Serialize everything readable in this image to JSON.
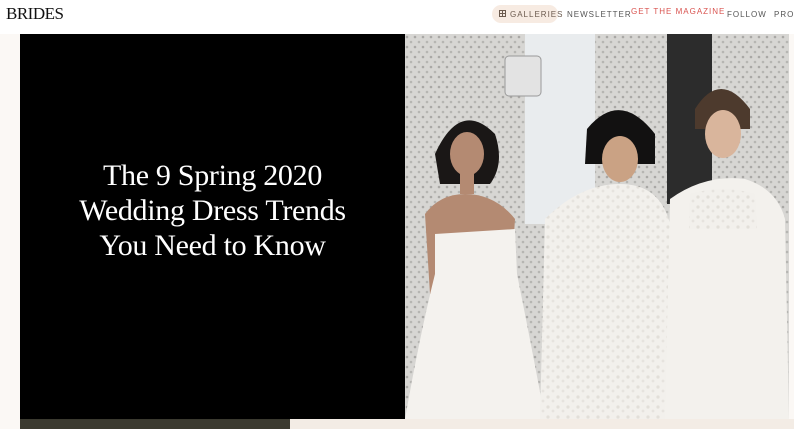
{
  "header": {
    "logo": "BRIDES",
    "nav": [
      {
        "label": "GALLERIES"
      },
      {
        "label": "NEWSLETTER"
      },
      {
        "label": "GET THE MAGAZINE"
      },
      {
        "label": "FOLLOW"
      },
      {
        "label": "PROF"
      }
    ]
  },
  "hero": {
    "title": "The 9 Spring 2020 Wedding Dress Trends You Need to Know"
  },
  "colors": {
    "panel": "#000000",
    "magazine_link": "#d9534f",
    "galleries_pill": "#f7ebe2"
  }
}
